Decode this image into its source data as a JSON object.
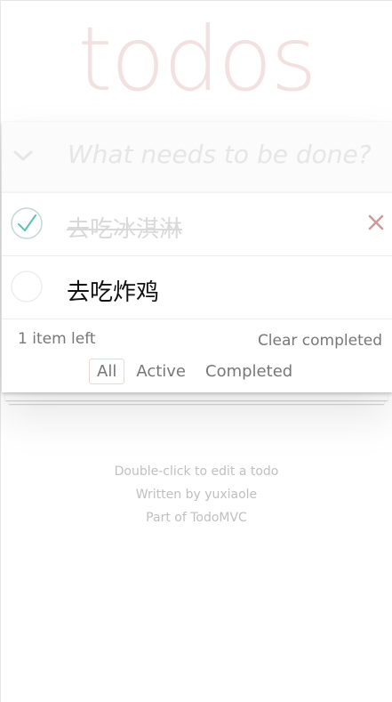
{
  "app": {
    "title": "todos"
  },
  "new_todo": {
    "placeholder": "What needs to be done?",
    "value": ""
  },
  "todos": [
    {
      "text": "去吃冰淇淋",
      "completed": true
    },
    {
      "text": "去吃炸鸡",
      "completed": false
    }
  ],
  "footer": {
    "count": "1",
    "count_suffix": "item left",
    "clear_label": "Clear completed",
    "filters": [
      {
        "label": "All",
        "selected": true
      },
      {
        "label": "Active",
        "selected": false
      },
      {
        "label": "Completed",
        "selected": false
      }
    ]
  },
  "info": {
    "line1": "Double-click to edit a todo",
    "line2": "Written by yuxiaole",
    "line3": "Part of TodoMVC"
  },
  "colors": {
    "title": "#f0dcdc",
    "check_done": "#5dc2af",
    "destroy": "#cc9a9a",
    "placeholder": "#e6e6e6"
  }
}
